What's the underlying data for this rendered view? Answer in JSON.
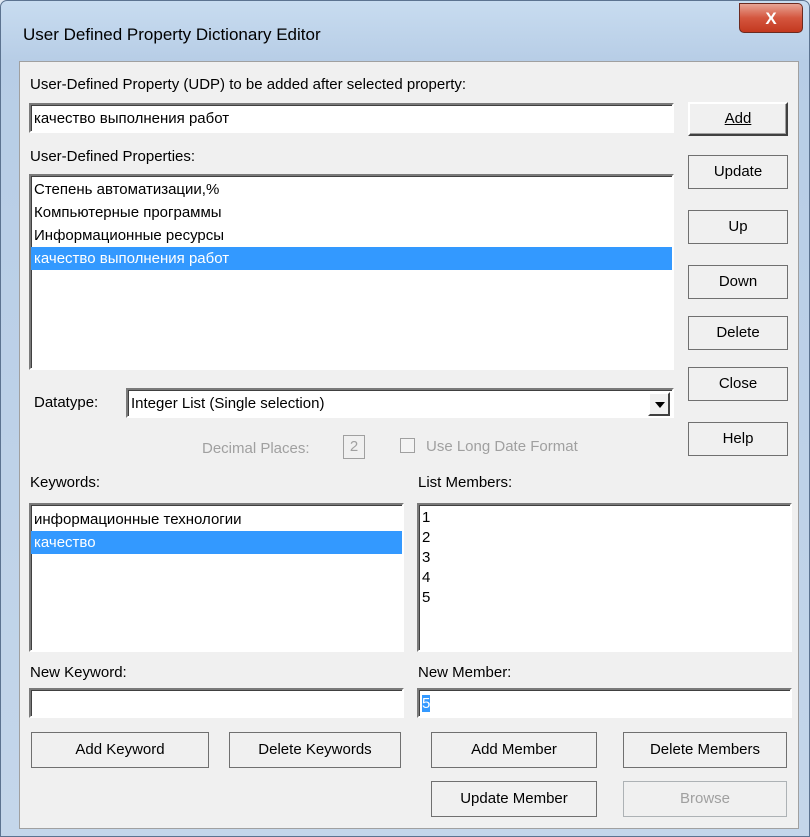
{
  "window": {
    "title": "User Defined Property Dictionary Editor",
    "close_label": "X"
  },
  "udp": {
    "label": "User-Defined Property (UDP)  to be added after selected property:",
    "value": "качество выполнения работ"
  },
  "properties": {
    "label": "User-Defined Properties:",
    "items": [
      {
        "text": "Степень автоматизации,%",
        "selected": false
      },
      {
        "text": "Компьютерные программы",
        "selected": false
      },
      {
        "text": "Информационные ресурсы",
        "selected": false
      },
      {
        "text": "качество выполнения работ",
        "selected": true
      }
    ]
  },
  "buttons": {
    "add": "Add",
    "update": "Update",
    "up": "Up",
    "down": "Down",
    "delete": "Delete",
    "close": "Close",
    "help": "Help"
  },
  "datatype": {
    "label": "Datatype:",
    "value": "Integer List (Single selection)"
  },
  "decimal": {
    "label": "Decimal Places:",
    "value": "2"
  },
  "long_date": {
    "label": "Use Long Date Format",
    "checked": false
  },
  "keywords": {
    "label": "Keywords:",
    "items": [
      {
        "text": "информационные технологии",
        "selected": false
      },
      {
        "text": "качество",
        "selected": true
      }
    ]
  },
  "list_members": {
    "label": "List Members:",
    "items": [
      {
        "text": "1"
      },
      {
        "text": "2"
      },
      {
        "text": "3"
      },
      {
        "text": "4"
      },
      {
        "text": "5"
      }
    ]
  },
  "new_keyword": {
    "label": "New Keyword:",
    "value": ""
  },
  "new_member": {
    "label": "New Member:",
    "value": "5"
  },
  "bottom_buttons": {
    "add_keyword": "Add Keyword",
    "delete_keywords": "Delete Keywords",
    "add_member": "Add Member",
    "delete_members": "Delete Members",
    "update_member": "Update Member",
    "browse": "Browse"
  },
  "colors": {
    "selection": "#3399ff",
    "title_gradient": "#b7cde6",
    "close_button": "#c3381f"
  }
}
